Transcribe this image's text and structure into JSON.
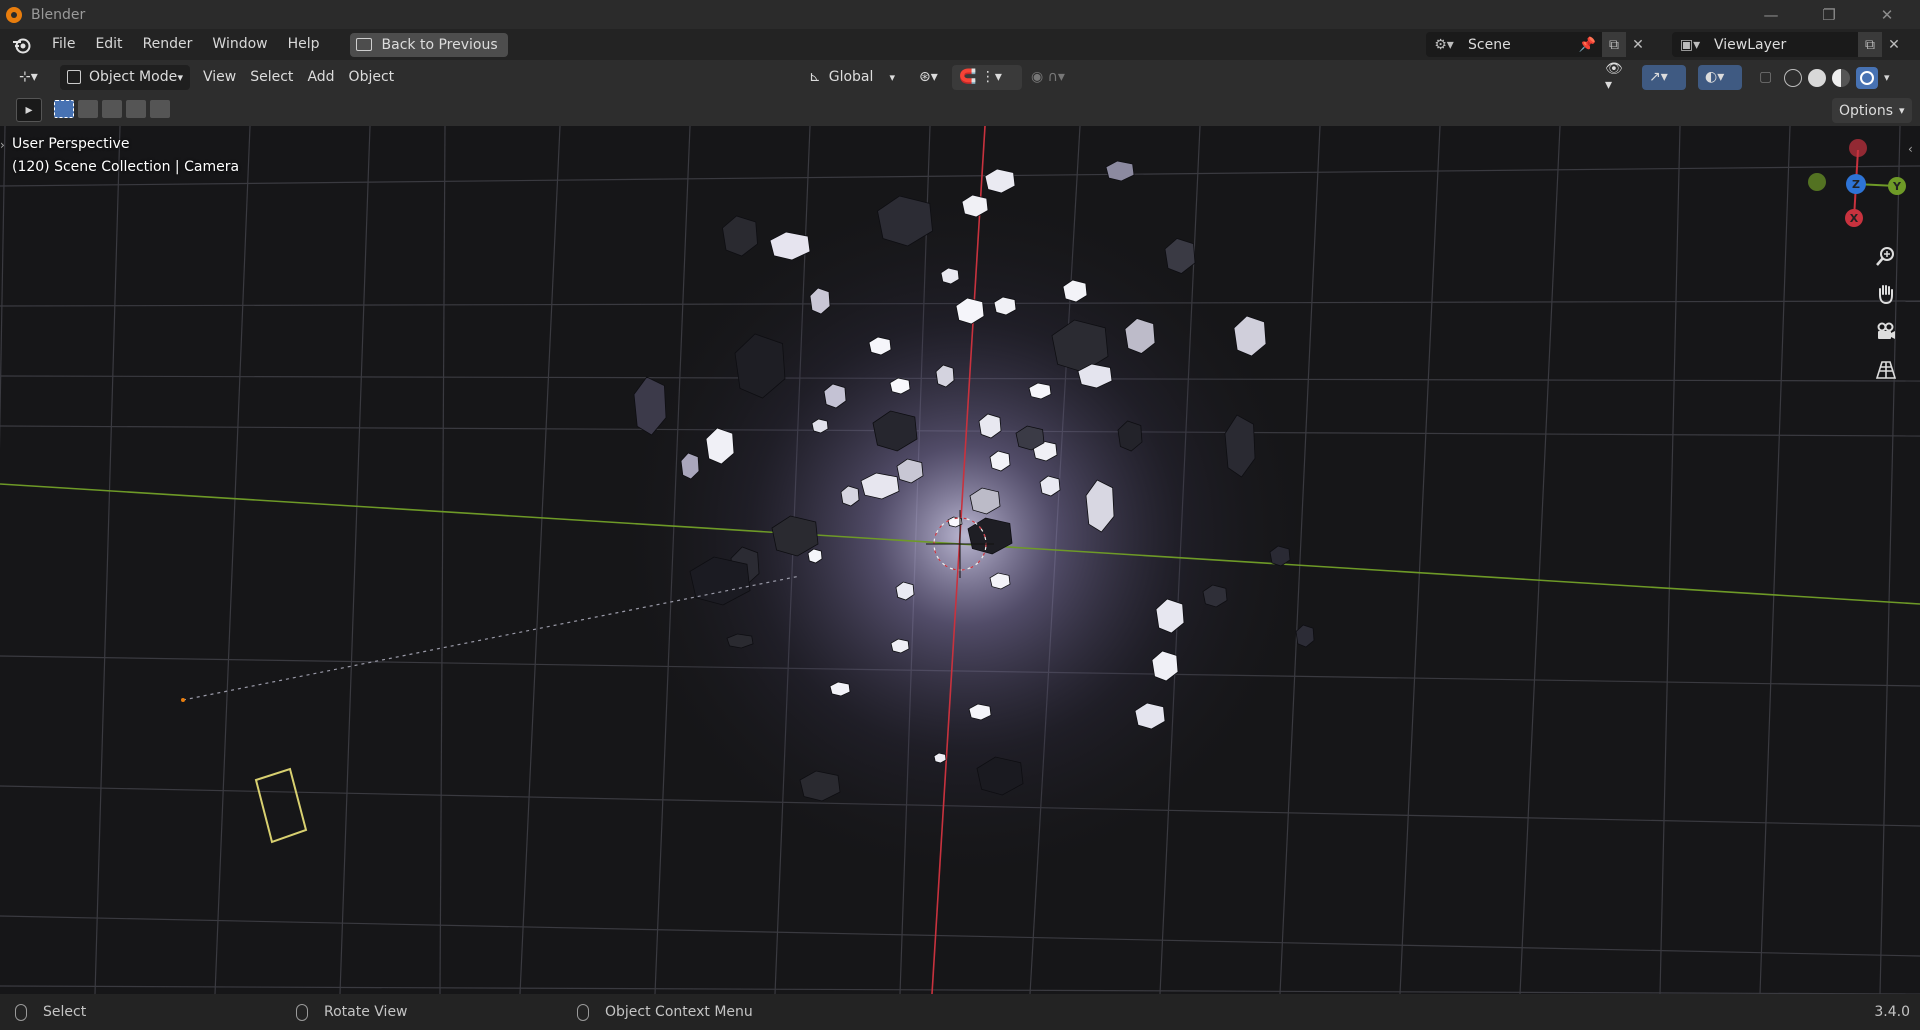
{
  "window": {
    "title": "Blender",
    "controls": [
      "minimize-icon",
      "restore-icon",
      "close-icon"
    ]
  },
  "menubar": {
    "items": [
      "File",
      "Edit",
      "Render",
      "Window",
      "Help"
    ],
    "back_button": "Back to Previous",
    "scene_label": "Scene",
    "viewlayer_label": "ViewLayer"
  },
  "header3d": {
    "mode": "Object Mode",
    "menus": [
      "View",
      "Select",
      "Add",
      "Object"
    ],
    "transform_orientation": "Global",
    "options_label": "Options"
  },
  "viewport": {
    "perspective_label": "User Perspective",
    "collection_label": "(120) Scene Collection | Camera",
    "gizmo": {
      "x": "X",
      "y": "Y",
      "z": "Z"
    },
    "colors": {
      "x_axis": "#c8323e",
      "y_axis": "#6e9a27",
      "z_axis": "#2e74d6",
      "camera": "#d8d070"
    }
  },
  "statusbar": {
    "select": "Select",
    "rotate": "Rotate View",
    "context": "Object Context Menu",
    "version": "3.4.0"
  }
}
